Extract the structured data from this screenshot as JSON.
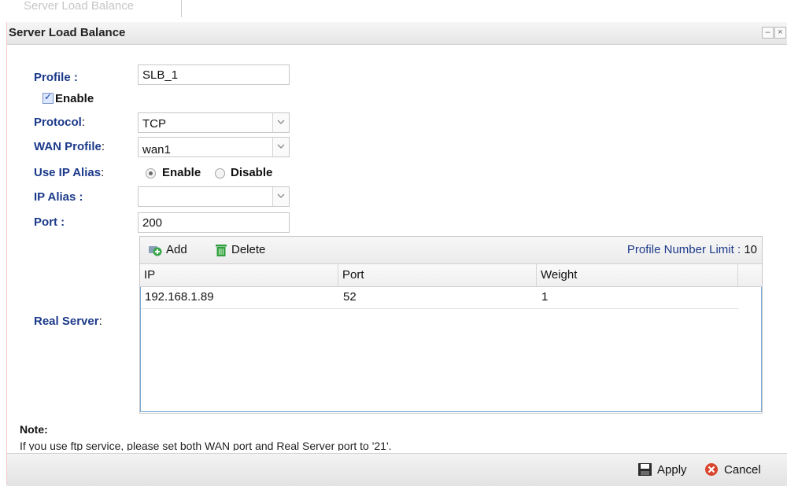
{
  "background_tab": {
    "label": "Server Load Balance"
  },
  "window": {
    "title": "Server Load Balance",
    "minimize_glyph": "–",
    "close_glyph": "×"
  },
  "form": {
    "profile": {
      "label": "Profile :",
      "value": "SLB_1"
    },
    "enable": {
      "label": "Enable",
      "checked": true
    },
    "protocol": {
      "label": "Protocol",
      "value": "TCP"
    },
    "wan_profile": {
      "label": "WAN Profile",
      "value": "wan1"
    },
    "use_ip_alias": {
      "label": "Use IP Alias",
      "options": [
        "Enable",
        "Disable"
      ],
      "selected": "Enable"
    },
    "ip_alias": {
      "label": "IP Alias :",
      "value": ""
    },
    "port": {
      "label": "Port :",
      "value": "200"
    },
    "real_server": {
      "label": "Real Server"
    }
  },
  "colon": ":",
  "grid": {
    "add_label": "Add",
    "delete_label": "Delete",
    "limit_label": "Profile Number Limit :",
    "limit_value": "10",
    "columns": [
      "IP",
      "Port",
      "Weight"
    ],
    "rows": [
      {
        "ip": "192.168.1.89",
        "port": "52",
        "weight": "1"
      }
    ]
  },
  "note": {
    "title": "Note:",
    "text": "If you use ftp service, please set both WAN port and Real Server port to '21'."
  },
  "footer": {
    "apply_label": "Apply",
    "cancel_label": "Cancel"
  },
  "icons": {
    "add": "add-icon",
    "delete": "trash-icon",
    "apply": "save-icon",
    "cancel": "cancel-icon",
    "dropdown": "chevron-down-icon"
  },
  "colors": {
    "label_blue": "#1c3a8a",
    "grid_border": "#7aa8d6",
    "cancel_red": "#d9452c",
    "add_green": "#3aa54a"
  }
}
